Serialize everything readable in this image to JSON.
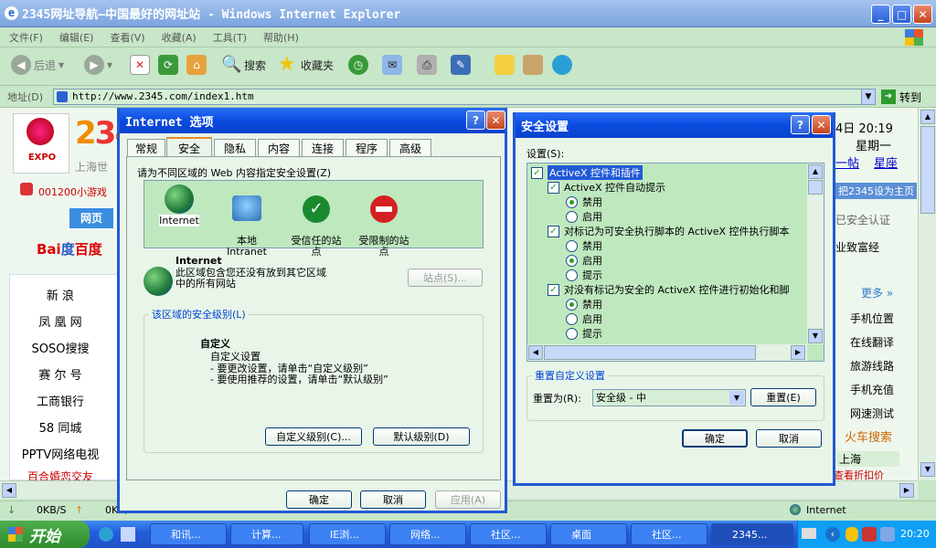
{
  "window": {
    "title": "2345网址导航—中国最好的网址站 - Windows Internet Explorer"
  },
  "menu": [
    "文件(F)",
    "编辑(E)",
    "查看(V)",
    "收藏(A)",
    "工具(T)",
    "帮助(H)"
  ],
  "toolbar": {
    "back": "后退",
    "search": "搜索",
    "favorites": "收藏夹"
  },
  "address": {
    "label": "地址(D)",
    "url": "http://www.2345.com/index1.htm",
    "go": "转到"
  },
  "page": {
    "game_link": "001200小游戏",
    "web_tab": "网页",
    "sidebar": [
      "新 浪",
      "凤 凰 网",
      "SOSO搜搜",
      "赛 尔 号",
      "工商银行",
      "58 同城",
      "PPTV网络电视",
      "百合婚恋交友"
    ],
    "expo_text": "上海世",
    "datetime": "4日 20:19",
    "weekday": "星期一",
    "link1": "一帖",
    "link2": "星座",
    "set_home": "把2345设为主页",
    "safety": "已安全认证",
    "wealth": "业致富经",
    "more": "更多 »",
    "right_links": [
      "手机位置",
      "在线翻译",
      "旅游线路",
      "手机充值",
      "网速测试"
    ],
    "train_search": "火车搜索",
    "shanghai": "上海",
    "discount": "查看折扣价"
  },
  "status": {
    "down": "0KB/S",
    "up": "0KB/S",
    "zone": "Internet"
  },
  "taskbar": {
    "start": "开始",
    "tasks": [
      "和讯...",
      "计算...",
      "IE浏...",
      "网络...",
      "社区...",
      "桌面",
      "社区...",
      "2345..."
    ],
    "time": "20:20"
  },
  "internet_options": {
    "title": "Internet 选项",
    "tabs": [
      "常规",
      "安全",
      "隐私",
      "内容",
      "连接",
      "程序",
      "高级"
    ],
    "instruction": "请为不同区域的 Web 内容指定安全设置(Z)",
    "zones": [
      {
        "label": "Internet",
        "icon": "globe-icon"
      },
      {
        "label": "本地\nIntranet",
        "icon": "computer-icon"
      },
      {
        "label": "受信任的站\n点",
        "icon": "checkmark-icon"
      },
      {
        "label": "受限制的站\n点",
        "icon": "no-entry-icon"
      }
    ],
    "zone_name": "Internet",
    "zone_desc": "此区域包含您还没有放到其它区域\n中的所有网站",
    "sites_button": "站点(S)...",
    "level_group": "该区域的安全级别(L)",
    "custom_title": "自定义",
    "custom_lines": [
      "自定义设置",
      "- 要更改设置，请单击“自定义级别”",
      "- 要使用推荐的设置，请单击“默认级别”"
    ],
    "custom_level_button": "自定义级别(C)...",
    "default_level_button": "默认级别(D)",
    "ok": "确定",
    "cancel": "取消",
    "apply": "应用(A)"
  },
  "security_settings": {
    "title": "安全设置",
    "settings_label": "设置(S):",
    "tree": [
      {
        "type": "category",
        "text": "ActiveX 控件和插件",
        "indent": 0
      },
      {
        "type": "category",
        "text": "ActiveX 控件自动提示",
        "indent": 1
      },
      {
        "type": "radio",
        "text": "禁用",
        "on": true
      },
      {
        "type": "radio",
        "text": "启用",
        "on": false
      },
      {
        "type": "category",
        "text": "对标记为可安全执行脚本的 ActiveX 控件执行脚本",
        "indent": 1
      },
      {
        "type": "radio",
        "text": "禁用",
        "on": false
      },
      {
        "type": "radio",
        "text": "启用",
        "on": true
      },
      {
        "type": "radio",
        "text": "提示",
        "on": false
      },
      {
        "type": "category",
        "text": "对没有标记为安全的 ActiveX 控件进行初始化和脚",
        "indent": 1
      },
      {
        "type": "radio",
        "text": "禁用",
        "on": true
      },
      {
        "type": "radio",
        "text": "启用",
        "on": false
      },
      {
        "type": "radio",
        "text": "提示",
        "on": false
      }
    ],
    "reset_group": "重置自定义设置",
    "reset_to_label": "重置为(R):",
    "reset_value": "安全级 - 中",
    "reset_button": "重置(E)",
    "ok": "确定",
    "cancel": "取消"
  }
}
